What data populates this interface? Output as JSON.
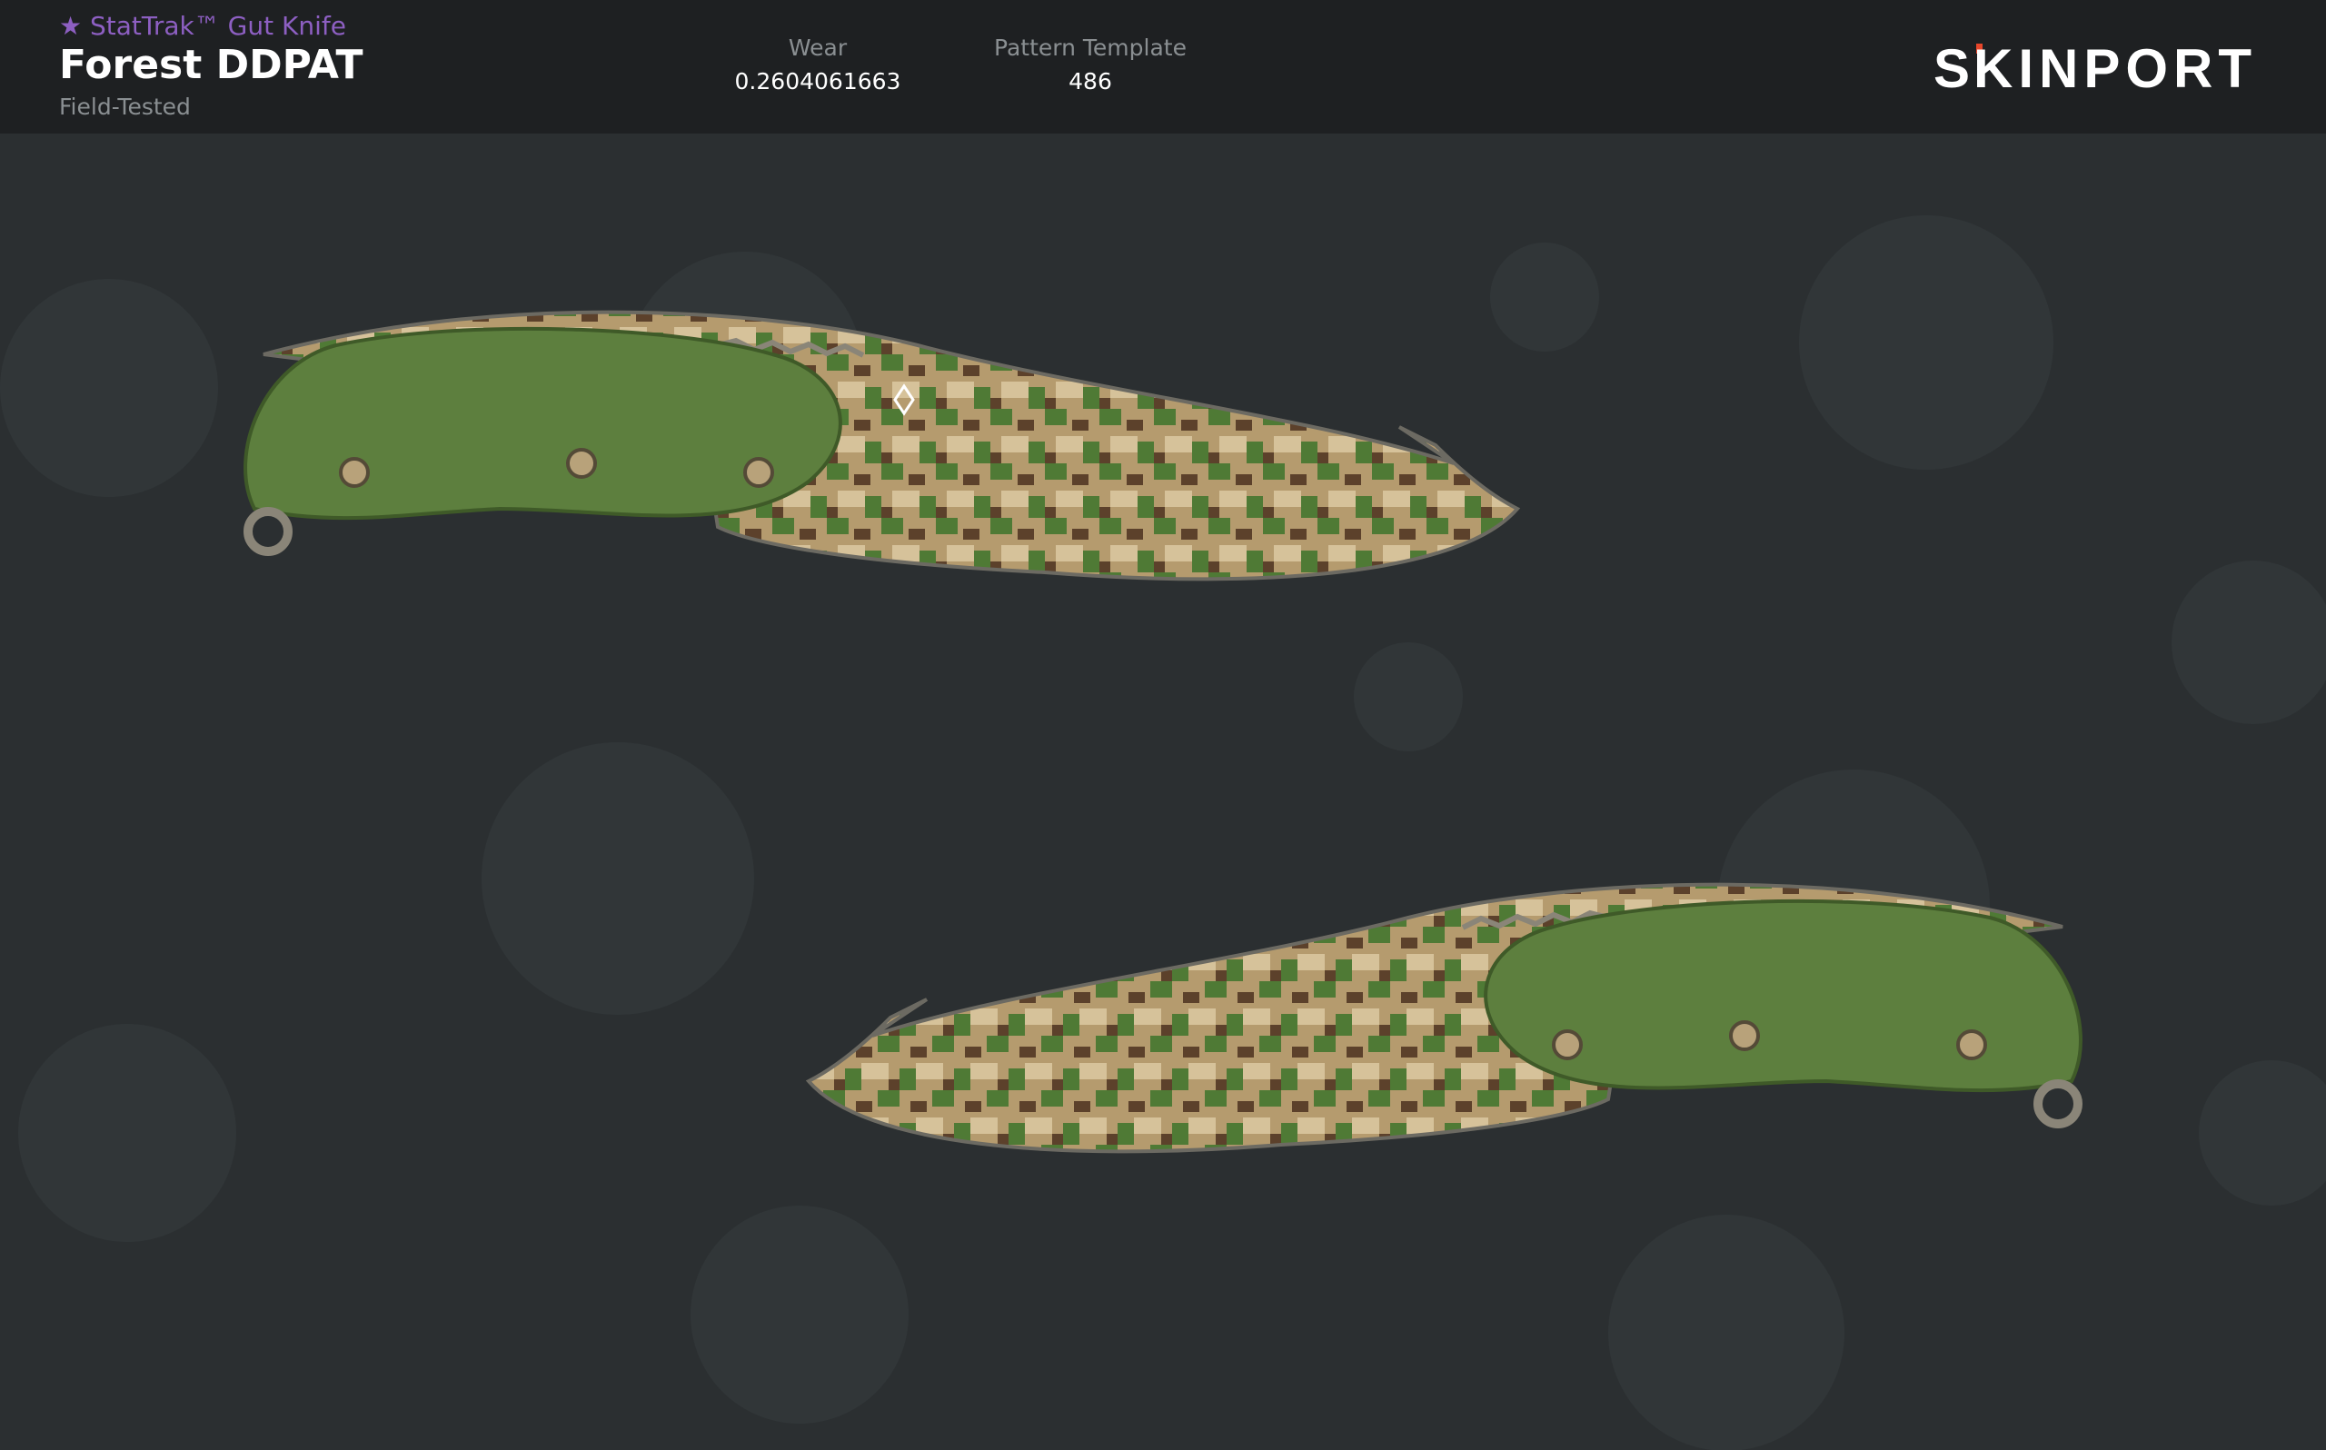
{
  "header": {
    "item_type": "★ StatTrak™ Gut Knife",
    "skin_name": "Forest DDPAT",
    "exterior": "Field-Tested",
    "wear": {
      "label": "Wear",
      "value": "0.2604061663"
    },
    "pattern": {
      "label": "Pattern Template",
      "value": "486"
    },
    "logo_text": "SKINPORT"
  },
  "colors": {
    "background": "#2b2f31",
    "header_background": "#1e2022",
    "stattrak_purple": "#8d5fc2",
    "logo_accent": "#e8462a",
    "handle_green": "#5d7f3e",
    "camo_tan": "#b59b6e",
    "camo_green": "#4f7a35",
    "camo_brown": "#5c412b"
  },
  "images": [
    {
      "name": "knife-top",
      "description_icon": "gut-knife-side-a"
    },
    {
      "name": "knife-bottom",
      "description_icon": "gut-knife-side-b"
    }
  ]
}
